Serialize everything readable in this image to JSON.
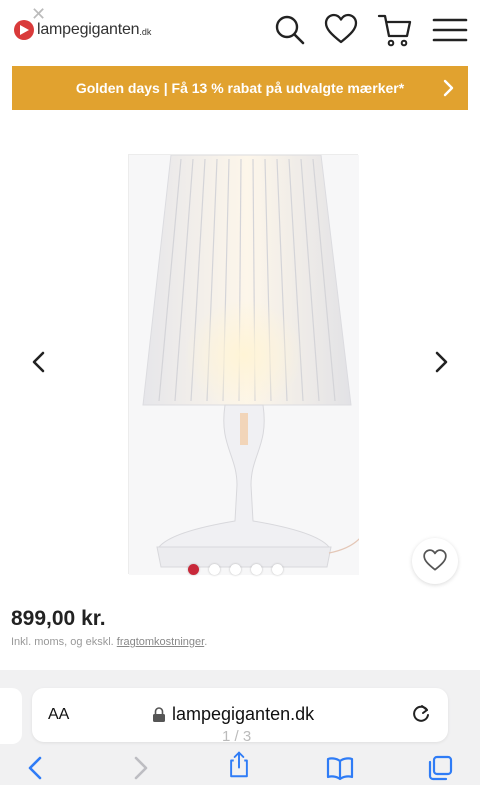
{
  "header": {
    "brand": "lampegiganten",
    "brand_tld": ".dk",
    "close_glyph": "✕",
    "icons": [
      "search-icon",
      "heart-icon",
      "cart-icon",
      "menu-icon"
    ]
  },
  "promo": {
    "text": "Golden days | Få 13 % rabat på udvalgte mærker*",
    "color": "#e1a22f"
  },
  "gallery": {
    "slide_count": 5,
    "active_slide": 1,
    "active_dot_color": "#c8283a"
  },
  "product": {
    "price": "899,00 kr.",
    "vat_prefix": "Inkl. moms, og ekskl. ",
    "vat_link": "fragtomkostninger",
    "vat_suffix": "."
  },
  "browser": {
    "aa_label": "AA",
    "url": "lampegiganten.dk",
    "page_indicator": "1 / 3"
  }
}
